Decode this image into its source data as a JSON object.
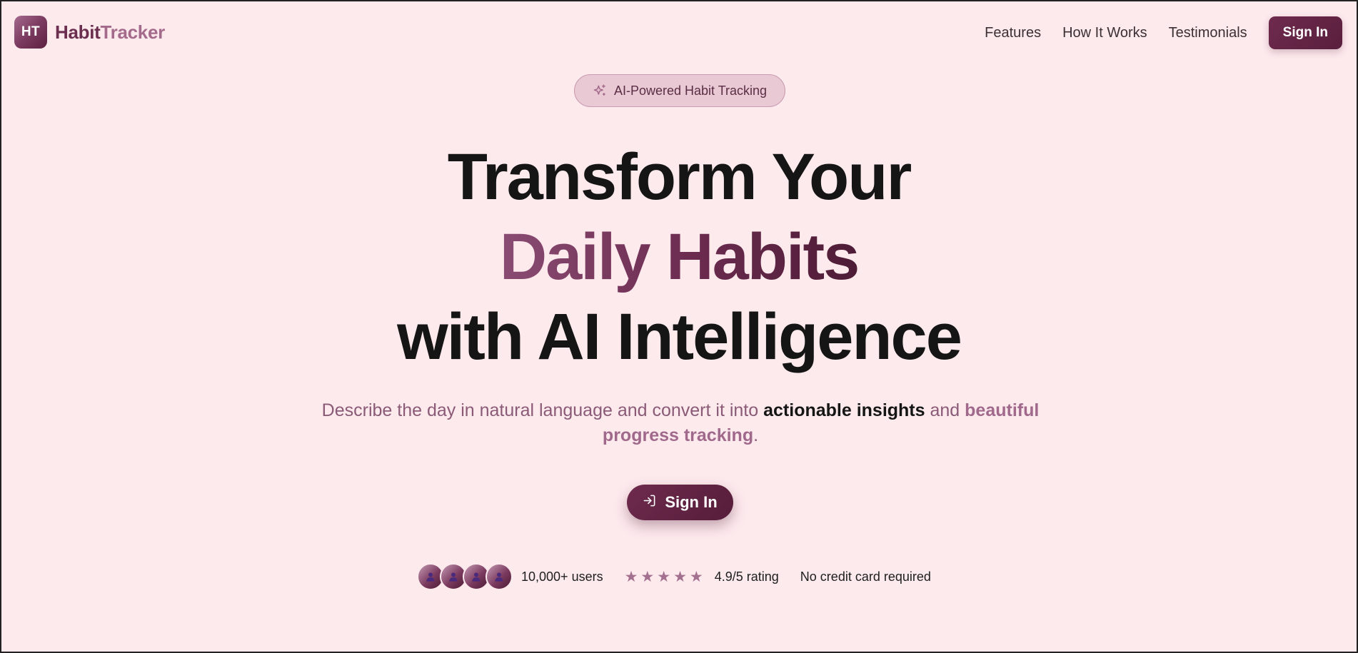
{
  "nav": {
    "logo_mark": "HT",
    "logo_text_a": "Habit",
    "logo_text_b": "Tracker",
    "links": [
      "Features",
      "How It Works",
      "Testimonials"
    ],
    "sign_in": "Sign In"
  },
  "badge": {
    "icon": "sparkles-icon",
    "label": "AI-Powered Habit Tracking"
  },
  "headline": {
    "line1": "Transform Your",
    "line2": "Daily Habits",
    "line3": "with AI Intelligence"
  },
  "subtitle": {
    "part1": "Describe the day in natural language and convert it into ",
    "strong": "actionable insights",
    "part2": " and ",
    "pink": "beautiful progress tracking",
    "part3": "."
  },
  "cta": {
    "icon": "sign-in-icon",
    "label": "Sign In"
  },
  "proof": {
    "avatar_count": 4,
    "users": "10,000+ users",
    "stars": 5,
    "rating": "4.9/5 rating",
    "no_card": "No credit card required"
  },
  "colors": {
    "background": "#fdeaed",
    "brand_dark": "#5a1f3d",
    "brand_light": "#a46a8b"
  }
}
